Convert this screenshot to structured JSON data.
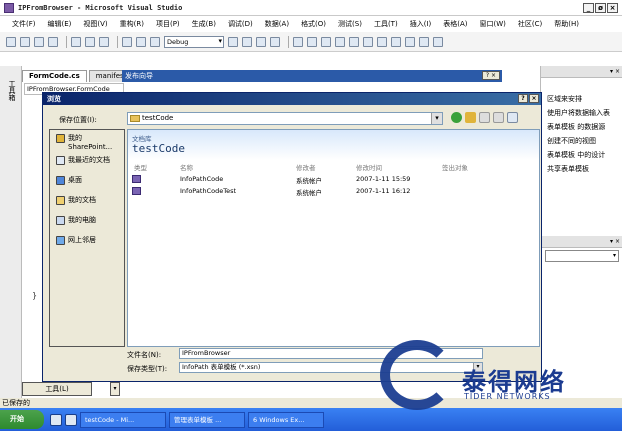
{
  "window": {
    "title": "IPFromBrowser - Microsoft Visual Studio",
    "controls": [
      "_",
      "ø",
      "×"
    ]
  },
  "menu": [
    "文件(F)",
    "编辑(E)",
    "视图(V)",
    "重构(R)",
    "项目(P)",
    "生成(B)",
    "调试(D)",
    "数据(A)",
    "格式(O)",
    "测试(S)",
    "工具(T)",
    "插入(I)",
    "表格(A)",
    "窗口(W)",
    "社区(C)",
    "帮助(H)"
  ],
  "toolbar": {
    "config_combo": "Debug"
  },
  "side_tab": "工具箱",
  "doc_tabs": [
    "FormCode.cs",
    "manifest"
  ],
  "wizard": {
    "title": "发布向导",
    "help": "?",
    "close": "×"
  },
  "editor": {
    "path": "IPFromBrowser.FormCode"
  },
  "right_panel": {
    "rows": [
      "区域来安排",
      "使用户将数据输入表",
      "表单模板 的数据源",
      "创建不同的视图",
      "表单模板 中的设计",
      "共享表单模板"
    ]
  },
  "dialog": {
    "title": "浏览",
    "save_location_label": "保存位置(I):",
    "save_location_value": "testCode",
    "places": [
      {
        "label": "我的 SharePoint..."
      },
      {
        "label": "我最近的文档"
      },
      {
        "label": "桌面"
      },
      {
        "label": "我的文档"
      },
      {
        "label": "我的电脑"
      },
      {
        "label": "网上邻居"
      }
    ],
    "library_label": "文档库",
    "library_name": "testCode",
    "columns": [
      "类型",
      "名称",
      "修改者",
      "修改时间",
      "签出对象"
    ],
    "files": [
      {
        "name": "InfoPathCode",
        "modified_by": "系统帐户",
        "modified": "2007-1-11 15:59"
      },
      {
        "name": "InfoPathCodeTest",
        "modified_by": "系统帐户",
        "modified": "2007-1-11 16:12"
      }
    ],
    "filename_label": "文件名(N):",
    "filename_value": "IPFromBrowser",
    "filetype_label": "保存类型(T):",
    "filetype_value": "InfoPath 表单模板 (*.xsn)",
    "tools_button": "工具(L)"
  },
  "status_text": "已保存的",
  "taskbar": {
    "start": "开始",
    "tasks": [
      "testCode - Mi...",
      "管理表单模板 ...",
      "6 Windows Ex..."
    ]
  },
  "watermark": {
    "zh": "泰得网络",
    "en": "TIDER NETWORKS"
  },
  "colors": {
    "dialog_title": "#0a246a",
    "taskbar": "#235ed8",
    "watermark": "#1b3b90"
  }
}
